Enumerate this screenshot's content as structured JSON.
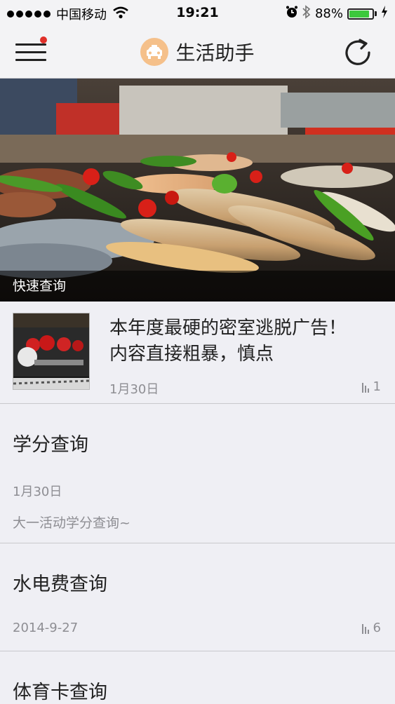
{
  "status_bar": {
    "carrier": "中国移动",
    "time": "19:21",
    "battery": "88%",
    "battery_level": 0.88
  },
  "nav": {
    "title": "生活助手",
    "menu_icon": "hamburger-menu-icon",
    "refresh_icon": "refresh-icon",
    "badge_color": "#e0302a"
  },
  "hero": {
    "caption": "快速查询"
  },
  "articles": [
    {
      "title": "本年度最硬的密室逃脱广告！内容直接粗暴，慎点",
      "date": "1月30日",
      "views": "1"
    },
    {
      "title": "学分查询",
      "date": "1月30日",
      "description": "大一活动学分查询~"
    },
    {
      "title": "水电费查询",
      "date": "2014-9-27",
      "views": "6"
    },
    {
      "title": "体育卡查询"
    }
  ]
}
